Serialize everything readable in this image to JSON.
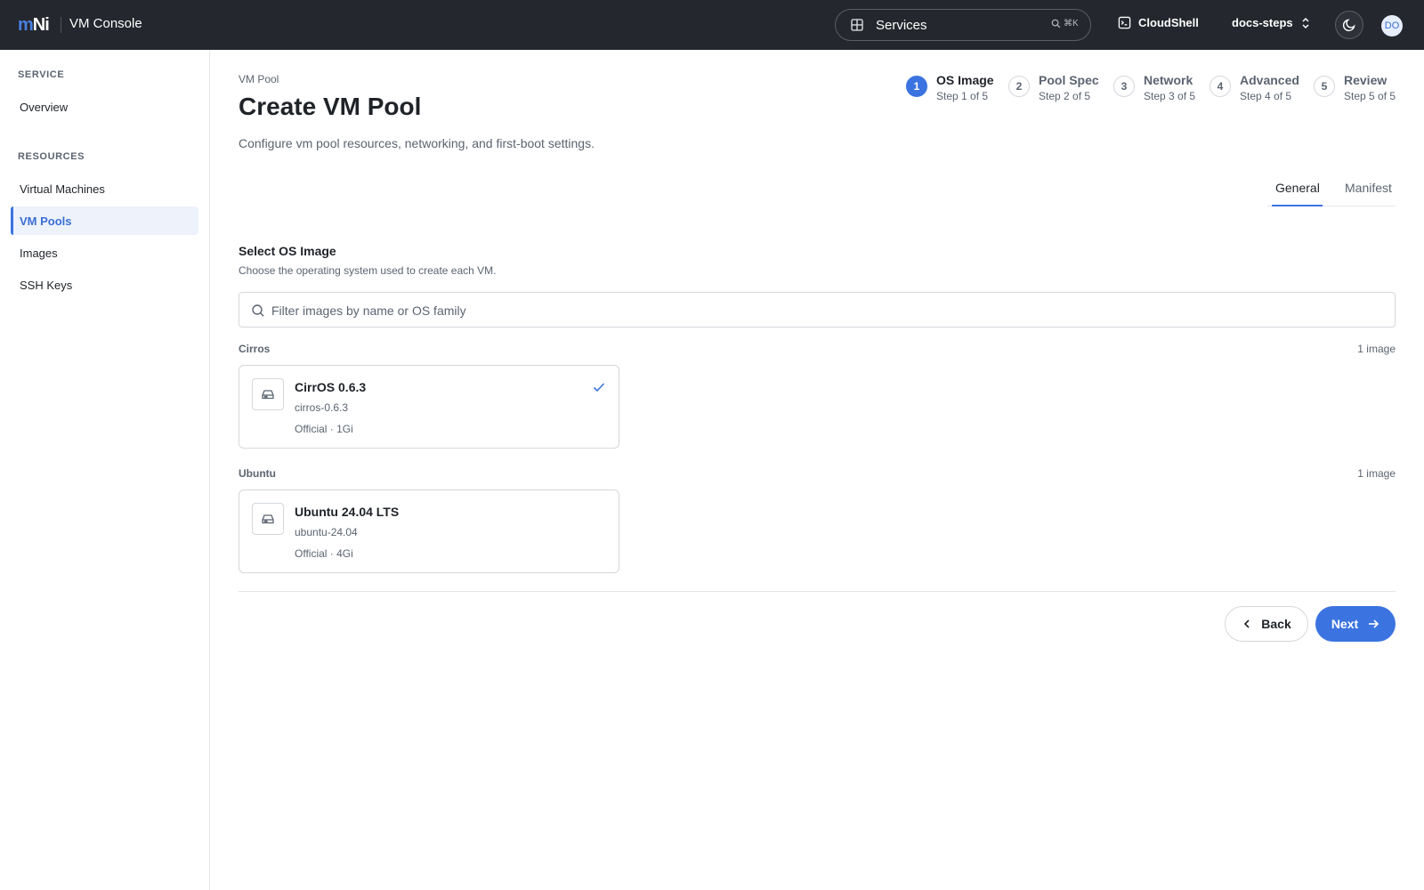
{
  "header": {
    "logo_m": "m",
    "logo_n": "Ni",
    "title": "VM Console",
    "services_label": "Services",
    "shortcut": "⌘K",
    "cloudshell_label": "CloudShell",
    "project_label": "docs-steps",
    "avatar_initials": "DO"
  },
  "sidebar": {
    "sections": [
      {
        "label": "SERVICE",
        "items": [
          {
            "label": "Overview"
          }
        ]
      },
      {
        "label": "RESOURCES",
        "items": [
          {
            "label": "Virtual Machines"
          },
          {
            "label": "VM Pools",
            "active": true
          },
          {
            "label": "Images"
          },
          {
            "label": "SSH Keys"
          }
        ]
      }
    ]
  },
  "page": {
    "breadcrumb": "VM Pool",
    "title": "Create VM Pool",
    "description": "Configure vm pool resources, networking, and first-boot settings."
  },
  "stepper": {
    "steps": [
      {
        "num": "1",
        "title": "OS Image",
        "sub": "Step 1 of 5",
        "active": true
      },
      {
        "num": "2",
        "title": "Pool Spec",
        "sub": "Step 2 of 5"
      },
      {
        "num": "3",
        "title": "Network",
        "sub": "Step 3 of 5"
      },
      {
        "num": "4",
        "title": "Advanced",
        "sub": "Step 4 of 5"
      },
      {
        "num": "5",
        "title": "Review",
        "sub": "Step 5 of 5"
      }
    ]
  },
  "tabs": [
    {
      "label": "General",
      "active": true
    },
    {
      "label": "Manifest"
    }
  ],
  "os_section": {
    "title": "Select OS Image",
    "description": "Choose the operating system used to create each VM.",
    "filter_placeholder": "Filter images by name or OS family",
    "groups": [
      {
        "label": "Cirros",
        "count": "1 image",
        "card": {
          "title": "CirrOS 0.6.3",
          "sub": "cirros-0.6.3",
          "meta": "Official · 1Gi",
          "selected": true
        }
      },
      {
        "label": "Ubuntu",
        "count": "1 image",
        "card": {
          "title": "Ubuntu 24.04 LTS",
          "sub": "ubuntu-24.04",
          "meta": "Official · 4Gi",
          "selected": false
        }
      }
    ]
  },
  "footer": {
    "back_label": "Back",
    "next_label": "Next"
  },
  "colors": {
    "accent": "#3b74e0",
    "topbar": "#24272d",
    "active_bg": "#edf2fb"
  }
}
